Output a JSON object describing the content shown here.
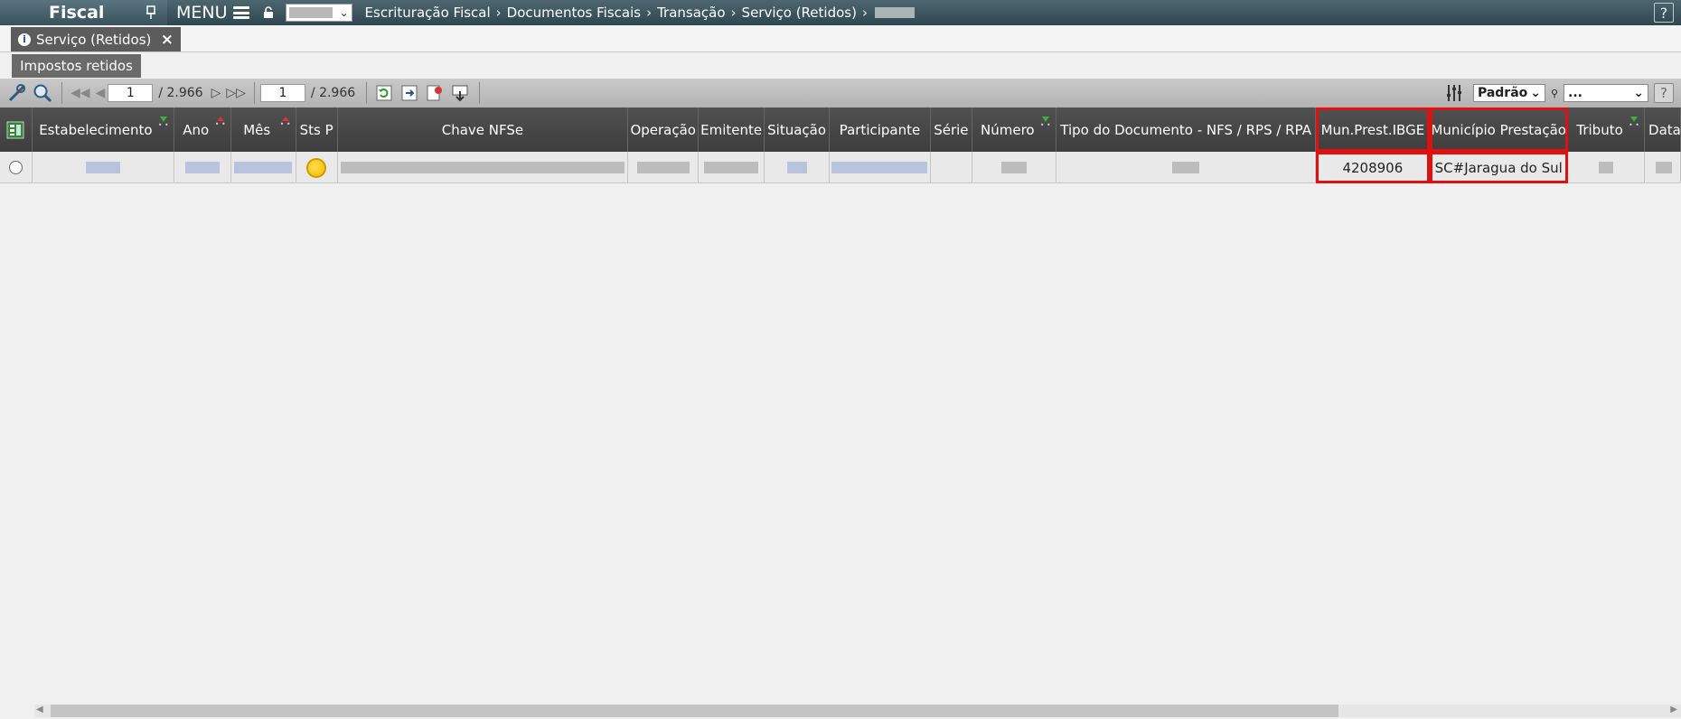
{
  "topbar": {
    "app_title": "Fiscal",
    "menu_label": "MENU",
    "breadcrumb": [
      "Escrituração Fiscal",
      "Documentos Fiscais",
      "Transação",
      "Serviço (Retidos)"
    ],
    "help_label": "?"
  },
  "tab": {
    "label": "Serviço (Retidos)",
    "close": "×",
    "info": "i"
  },
  "subtab": {
    "label": "Impostos retidos"
  },
  "toolbar": {
    "page1": {
      "value": "1",
      "total": "/ 2.966"
    },
    "page2": {
      "value": "1",
      "total": "/ 2.966"
    },
    "view_select": "Padrão",
    "filter_select": "...",
    "help_label": "?"
  },
  "grid": {
    "columns": [
      {
        "label": ""
      },
      {
        "label": "Estabelecimento"
      },
      {
        "label": "Ano"
      },
      {
        "label": "Mês"
      },
      {
        "label": "Sts P"
      },
      {
        "label": "Chave NFSe"
      },
      {
        "label": "Operação"
      },
      {
        "label": "Emitente"
      },
      {
        "label": "Situação"
      },
      {
        "label": "Participante"
      },
      {
        "label": "Série"
      },
      {
        "label": "Número"
      },
      {
        "label": "Tipo do Documento - NFS / RPS / RPA"
      },
      {
        "label": "Mun.Prest.IBGE"
      },
      {
        "label": "Município Prestação"
      },
      {
        "label": "Tributo"
      },
      {
        "label": "Data"
      }
    ],
    "row": {
      "mun_prest_ibge": "4208906",
      "municipio_prestacao": "SC#Jaragua do Sul"
    }
  },
  "colors": {
    "topbar": "#2e4650",
    "header": "#444444",
    "highlight": "#e01010",
    "status_yellow": "#f5b800"
  }
}
